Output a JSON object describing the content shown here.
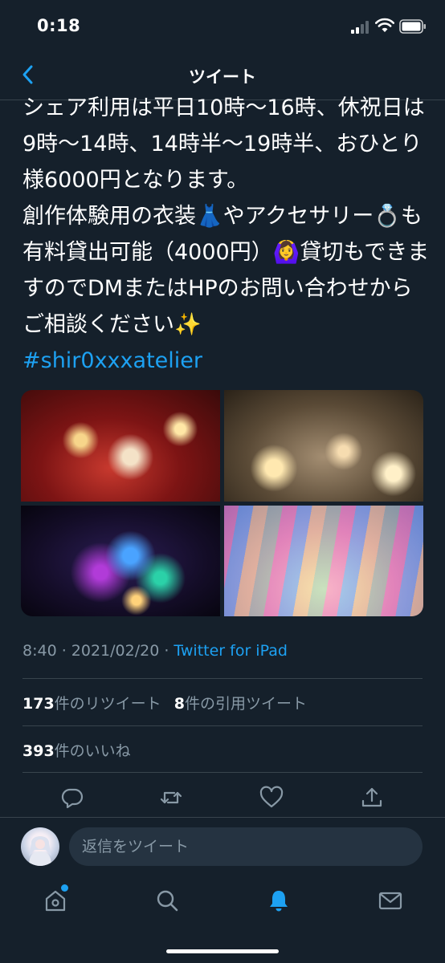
{
  "status_bar": {
    "time": "0:18"
  },
  "nav": {
    "title": "ツイート"
  },
  "tweet": {
    "text": "シェア利用は平日10時〜16時、休祝日は9時〜14時、14時半〜19時半、おひとり様6000円となります。\n創作体験用の衣装👗やアクセサリー💍も有料貸出可能（4000円）🙆‍♀️貸切もできますのでDMまたはHPのお問い合わせからご相談ください✨",
    "hashtag": "#shir0xxxatelier",
    "time": "8:40 · 2021/02/20 · ",
    "source": "Twitter for iPad"
  },
  "stats": {
    "retweets_count": "173",
    "retweets_label": "件のリツイート",
    "quotes_count": "8",
    "quotes_label": "件の引用ツイート",
    "likes_count": "393",
    "likes_label": "件のいいね"
  },
  "reply": {
    "placeholder": "返信をツイート"
  },
  "icons": {
    "back": "chevron-left-icon",
    "reply": "reply-icon",
    "retweet": "retweet-icon",
    "like": "heart-icon",
    "share": "share-icon",
    "home": "home-icon",
    "search": "search-icon",
    "notifications": "bell-icon",
    "messages": "mail-icon"
  },
  "colors": {
    "background": "#15202b",
    "accent": "#1da1f2",
    "secondary_text": "#8899a6",
    "divider": "#38444d"
  }
}
